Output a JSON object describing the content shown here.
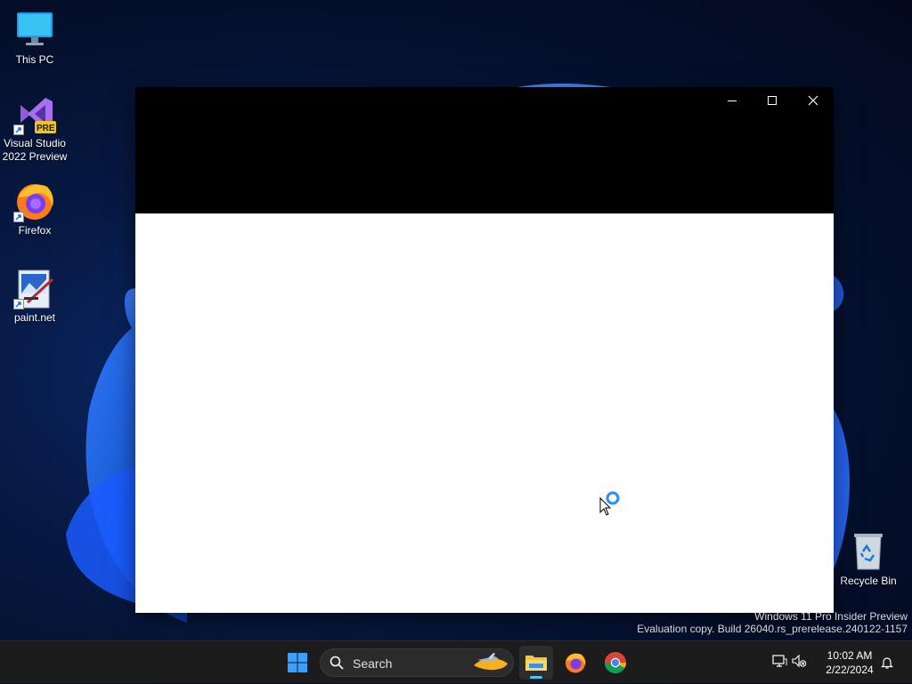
{
  "desktop": {
    "icons": [
      {
        "label": "This PC",
        "icon": "computer-icon"
      },
      {
        "label": "Visual Studio 2022 Preview",
        "icon": "visual-studio-icon",
        "badge": "PRE"
      },
      {
        "label": "Firefox",
        "icon": "firefox-icon"
      },
      {
        "label": "paint.net",
        "icon": "paintnet-icon"
      },
      {
        "label": "Recycle Bin",
        "icon": "recycle-bin-icon"
      }
    ]
  },
  "window": {
    "title": "",
    "controls": {
      "minimize": "minimize-icon",
      "maximize": "maximize-icon",
      "close": "close-icon"
    }
  },
  "watermark": {
    "line1": "Windows 11 Pro Insider Preview",
    "line2": "Evaluation copy. Build 26040.rs_prerelease.240122-1157"
  },
  "taskbar": {
    "search_label": "Search",
    "apps": [
      "start-icon",
      "file-explorer-icon",
      "firefox-icon",
      "chrome-icon"
    ],
    "clock": {
      "time": "10:02 AM",
      "date": "2/22/2024"
    }
  },
  "colors": {
    "accent": "#4cc2ff",
    "taskbar": "#1c1c1c",
    "titlebar": "#000000",
    "wallpaper": "#071a45"
  }
}
